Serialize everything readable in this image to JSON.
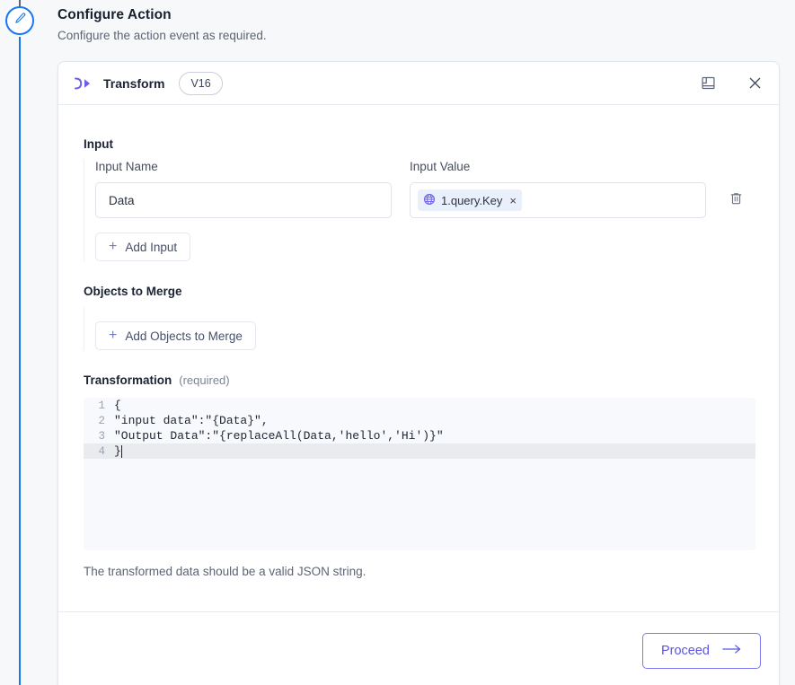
{
  "page": {
    "title": "Configure Action",
    "subtitle": "Configure the action event as required."
  },
  "rail": {
    "node_icon": "pencil-icon"
  },
  "card": {
    "node_icon": "transform-arrow-icon",
    "node_title": "Transform",
    "version": "V16",
    "actions": {
      "docs_icon": "book-icon",
      "close_icon": "close-icon"
    }
  },
  "input_section": {
    "label": "Input",
    "name_label": "Input Name",
    "value_label": "Input Value",
    "name_value": "Data",
    "name_placeholder": "",
    "chip": {
      "icon": "globe-icon",
      "text": "1.query.Key",
      "remove": "×"
    },
    "delete_icon": "trash-icon",
    "add_button": "Add Input"
  },
  "merge_section": {
    "label": "Objects to Merge",
    "add_button": "Add Objects to Merge"
  },
  "transformation": {
    "label": "Transformation",
    "required": "(required)",
    "lines": [
      {
        "num": "1",
        "text": "{",
        "active": false
      },
      {
        "num": "2",
        "text": "\"input data\":\"{Data}\",",
        "active": false
      },
      {
        "num": "3",
        "text": "\"Output Data\":\"{replaceAll(Data,'hello','Hi')}\"",
        "active": false
      },
      {
        "num": "4",
        "text": "}",
        "active": true
      }
    ],
    "helper": "The transformed data should be a valid JSON string."
  },
  "footer": {
    "proceed_label": "Proceed",
    "proceed_icon": "arrow-right-icon"
  },
  "colors": {
    "accent_purple": "#5b55e8",
    "rail_blue": "#1877f2",
    "chip_bg": "#eaf0fb",
    "page_bg": "#f7f8fa"
  }
}
